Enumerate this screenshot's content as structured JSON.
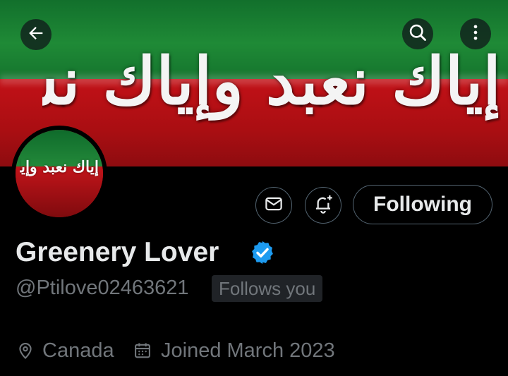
{
  "header": {
    "banner_text": "إياك نعبد وإياك نستعين",
    "back_icon": "arrow-left-icon",
    "search_icon": "search-icon",
    "more_icon": "more-vertical-icon"
  },
  "profile": {
    "avatar_text": "إياك نعبد وإياك نستعين",
    "display_name": "Greenery Lover",
    "handle": "@Ptilove02463621",
    "follows_you": "Follows you",
    "location": "Canada",
    "joined": "Joined March 2023"
  },
  "actions": {
    "message_icon": "envelope-icon",
    "notify_icon": "bell-plus-icon",
    "follow_label": "Following"
  },
  "colors": {
    "background": "#000000",
    "verified": "#1d9bf0",
    "muted_text": "#71767b",
    "border": "#536471",
    "banner_green": "#1f8a36",
    "banner_red": "#b30f14"
  }
}
